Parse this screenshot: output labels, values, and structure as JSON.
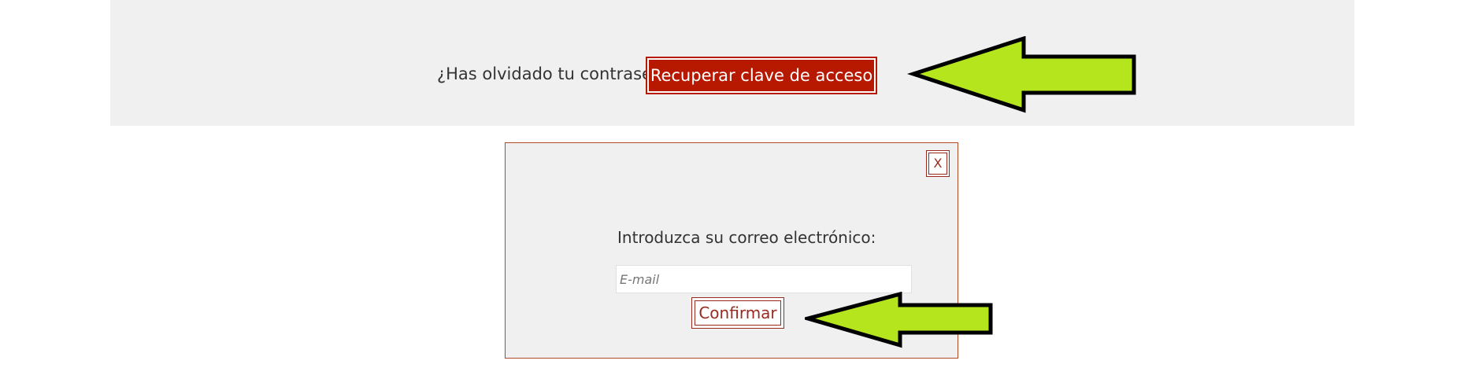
{
  "forgot_section": {
    "question": "¿Has olvidado tu contraseña?",
    "recover_label": "Recuperar clave de acceso"
  },
  "modal": {
    "close_label": "X",
    "email_label": "Introduzca su correo electrónico:",
    "email_placeholder": "E-mail",
    "email_value": "",
    "confirm_label": "Confirmar"
  },
  "colors": {
    "band_background": "#f0f0f0",
    "recover_button": "#b61800",
    "accent_dark_red": "#9a2a20",
    "arrow_fill": "#b5e61d",
    "arrow_stroke": "#000000"
  },
  "icons": {
    "annotation": "arrow-left-icon"
  }
}
